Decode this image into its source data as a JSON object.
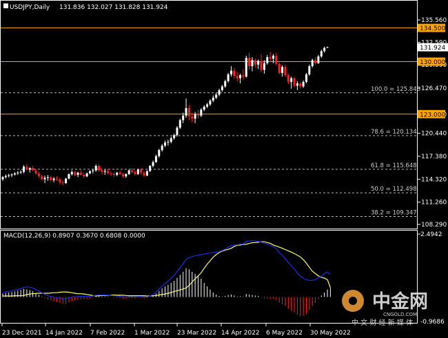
{
  "header": {
    "symbol_label": "USDJPY,Daily",
    "ohlc_text": "131.836 132.027 131.828 131.924"
  },
  "price_axis": {
    "ticks": [
      "135.560",
      "132.590",
      "129.590",
      "126.470",
      "123.000",
      "120.440",
      "117.380",
      "114.320",
      "111.260",
      "108.290"
    ]
  },
  "horizontal_levels": [
    {
      "label": "134.500",
      "color": "#ffa500"
    },
    {
      "label": "130.000",
      "color": "#ffa500"
    },
    {
      "label": "123.000",
      "color": "#ffa500"
    }
  ],
  "current_price_label": "131.924",
  "fibonacci_levels": [
    {
      "label": "100.0 = 125.848",
      "price": 125.848
    },
    {
      "label": "78.6 = 120.134",
      "price": 120.134
    },
    {
      "label": "61.8 = 115.648",
      "price": 115.648
    },
    {
      "label": "50.0 = 112.498",
      "price": 112.498
    },
    {
      "label": "38.2 = 109.347",
      "price": 109.347
    }
  ],
  "macd": {
    "header": "MACD(12,26,9) 0.8907 0.3670 0.6808 0.0000",
    "axis_top": "2.4942",
    "axis_bottom": "-0.9686"
  },
  "time_axis": {
    "labels": [
      "23 Dec 2021",
      "14 Jan 2022",
      "7 Feb 2022",
      "1 Mar 2022",
      "23 Mar 2022",
      "14 Apr 2022",
      "6 May 2022",
      "30 May 2022"
    ]
  },
  "watermark": {
    "brand_cn": "中金网",
    "domain": "CNGOLD.COM",
    "tagline": "中 文 财 经 新 媒 体"
  },
  "colors": {
    "bull": "#ffffff",
    "bear": "#ff2020",
    "level": "#ffa500",
    "macd_line": "#1a2be8",
    "signal_line": "#ffff66"
  },
  "chart_data": {
    "type": "candlestick",
    "instrument": "USDJPY",
    "timeframe": "Daily",
    "ylim": [
      108.29,
      135.56
    ],
    "x_labels": [
      "23 Dec 2021",
      "14 Jan 2022",
      "7 Feb 2022",
      "1 Mar 2022",
      "23 Mar 2022",
      "14 Apr 2022",
      "6 May 2022",
      "30 May 2022"
    ],
    "candles": [
      [
        114.3,
        114.75,
        114.1,
        114.6
      ],
      [
        114.6,
        114.95,
        114.4,
        114.75
      ],
      [
        114.75,
        115.05,
        114.55,
        114.85
      ],
      [
        114.85,
        115.1,
        114.6,
        114.95
      ],
      [
        114.95,
        115.25,
        114.8,
        115.1
      ],
      [
        115.1,
        115.4,
        114.9,
        115.2
      ],
      [
        115.2,
        115.5,
        115.0,
        115.3
      ],
      [
        115.3,
        116.2,
        115.1,
        116.0
      ],
      [
        116.0,
        116.35,
        115.5,
        115.6
      ],
      [
        115.6,
        115.9,
        115.2,
        115.8
      ],
      [
        115.8,
        116.1,
        115.4,
        115.5
      ],
      [
        115.5,
        115.7,
        114.9,
        115.1
      ],
      [
        115.1,
        115.3,
        114.5,
        114.7
      ],
      [
        114.7,
        114.9,
        114.2,
        114.3
      ],
      [
        114.3,
        114.8,
        113.8,
        114.5
      ],
      [
        114.5,
        114.9,
        114.1,
        114.6
      ],
      [
        114.6,
        114.8,
        114.0,
        114.2
      ],
      [
        114.2,
        114.6,
        113.9,
        114.4
      ],
      [
        114.4,
        114.7,
        114.1,
        114.3
      ],
      [
        114.3,
        114.5,
        113.6,
        113.9
      ],
      [
        113.9,
        114.2,
        113.5,
        113.8
      ],
      [
        113.8,
        114.5,
        113.7,
        114.4
      ],
      [
        114.4,
        115.1,
        114.3,
        115.0
      ],
      [
        115.0,
        115.5,
        114.8,
        115.3
      ],
      [
        115.3,
        115.4,
        114.7,
        114.9
      ],
      [
        114.9,
        115.3,
        114.6,
        115.2
      ],
      [
        115.2,
        115.5,
        114.8,
        114.9
      ],
      [
        114.9,
        115.2,
        114.5,
        114.7
      ],
      [
        114.7,
        115.2,
        114.6,
        115.1
      ],
      [
        115.1,
        115.5,
        115.0,
        115.4
      ],
      [
        115.4,
        115.7,
        115.1,
        115.5
      ],
      [
        115.5,
        116.3,
        115.3,
        116.1
      ],
      [
        116.1,
        116.3,
        115.3,
        115.5
      ],
      [
        115.5,
        115.8,
        115.0,
        115.3
      ],
      [
        115.3,
        115.6,
        114.9,
        115.4
      ],
      [
        115.4,
        115.7,
        115.0,
        115.1
      ],
      [
        115.1,
        115.4,
        114.7,
        115.0
      ],
      [
        115.0,
        115.3,
        114.6,
        114.9
      ],
      [
        114.9,
        115.3,
        114.7,
        115.2
      ],
      [
        115.2,
        115.5,
        114.9,
        115.0
      ],
      [
        115.0,
        115.2,
        114.5,
        114.7
      ],
      [
        114.7,
        115.1,
        114.5,
        115.0
      ],
      [
        115.0,
        115.6,
        114.9,
        115.5
      ],
      [
        115.5,
        115.8,
        115.1,
        115.3
      ],
      [
        115.3,
        115.5,
        114.8,
        115.0
      ],
      [
        115.0,
        115.7,
        114.9,
        115.6
      ],
      [
        115.6,
        115.8,
        115.0,
        115.2
      ],
      [
        115.2,
        115.4,
        114.6,
        114.8
      ],
      [
        114.8,
        115.5,
        114.7,
        115.4
      ],
      [
        115.4,
        116.2,
        115.3,
        116.1
      ],
      [
        116.1,
        116.8,
        115.9,
        116.6
      ],
      [
        116.6,
        117.6,
        116.5,
        117.4
      ],
      [
        117.4,
        118.4,
        117.2,
        118.2
      ],
      [
        118.2,
        119.0,
        118.0,
        118.8
      ],
      [
        118.8,
        119.5,
        118.6,
        119.2
      ],
      [
        119.2,
        119.6,
        118.8,
        119.3
      ],
      [
        119.3,
        120.0,
        119.1,
        119.8
      ],
      [
        119.8,
        120.4,
        119.6,
        120.2
      ],
      [
        120.2,
        121.4,
        120.0,
        121.2
      ],
      [
        121.2,
        122.4,
        121.0,
        122.2
      ],
      [
        122.2,
        123.2,
        121.8,
        122.8
      ],
      [
        122.8,
        125.1,
        122.5,
        123.8
      ],
      [
        123.8,
        124.2,
        122.2,
        122.7
      ],
      [
        122.7,
        123.2,
        121.9,
        122.4
      ],
      [
        122.4,
        123.3,
        121.8,
        123.0
      ],
      [
        123.0,
        123.6,
        122.4,
        122.8
      ],
      [
        122.8,
        123.8,
        122.6,
        123.6
      ],
      [
        123.6,
        124.2,
        123.4,
        124.0
      ],
      [
        124.0,
        124.5,
        123.8,
        124.3
      ],
      [
        124.3,
        125.0,
        124.1,
        124.8
      ],
      [
        124.8,
        125.5,
        124.6,
        125.2
      ],
      [
        125.2,
        125.8,
        125.0,
        125.6
      ],
      [
        125.6,
        126.4,
        125.4,
        126.2
      ],
      [
        126.2,
        126.9,
        126.0,
        126.7
      ],
      [
        126.7,
        127.6,
        126.5,
        127.4
      ],
      [
        127.4,
        128.5,
        127.2,
        128.3
      ],
      [
        128.3,
        129.4,
        128.0,
        128.8
      ],
      [
        128.8,
        129.2,
        127.7,
        128.1
      ],
      [
        128.1,
        128.6,
        127.4,
        127.8
      ],
      [
        127.8,
        128.4,
        127.1,
        128.2
      ],
      [
        128.2,
        129.0,
        127.6,
        128.0
      ],
      [
        128.0,
        130.8,
        127.9,
        130.5
      ],
      [
        130.5,
        131.2,
        128.9,
        129.4
      ],
      [
        129.4,
        130.6,
        128.7,
        130.2
      ],
      [
        130.2,
        130.4,
        129.2,
        129.6
      ],
      [
        129.6,
        130.3,
        129.0,
        130.1
      ],
      [
        130.1,
        131.0,
        128.6,
        128.9
      ],
      [
        128.9,
        130.2,
        128.4,
        129.8
      ],
      [
        129.8,
        130.9,
        129.6,
        130.6
      ],
      [
        130.6,
        131.3,
        130.1,
        130.4
      ],
      [
        130.4,
        131.0,
        129.8,
        130.8
      ],
      [
        130.8,
        131.2,
        129.5,
        129.7
      ],
      [
        129.7,
        129.9,
        128.3,
        128.5
      ],
      [
        128.5,
        129.5,
        128.0,
        129.3
      ],
      [
        129.3,
        129.6,
        128.0,
        128.2
      ],
      [
        128.2,
        128.4,
        127.0,
        127.3
      ],
      [
        127.3,
        128.0,
        126.4,
        127.8
      ],
      [
        127.8,
        128.0,
        126.6,
        126.8
      ],
      [
        126.8,
        127.4,
        126.2,
        127.1
      ],
      [
        127.1,
        127.3,
        126.4,
        126.7
      ],
      [
        126.7,
        127.5,
        126.5,
        127.3
      ],
      [
        127.3,
        128.5,
        127.1,
        128.3
      ],
      [
        128.3,
        129.6,
        128.1,
        129.4
      ],
      [
        129.4,
        130.4,
        129.2,
        130.2
      ],
      [
        130.2,
        130.6,
        129.6,
        129.8
      ],
      [
        129.8,
        130.9,
        129.7,
        130.7
      ],
      [
        130.7,
        131.6,
        130.5,
        131.4
      ],
      [
        131.4,
        132.0,
        131.2,
        131.836
      ],
      [
        131.836,
        132.027,
        131.828,
        131.924
      ]
    ],
    "macd_indicator": {
      "params": "MACD(12,26,9)",
      "ylim": [
        -0.9686,
        2.4942
      ],
      "histogram": [
        0.14,
        0.16,
        0.18,
        0.2,
        0.22,
        0.25,
        0.28,
        0.32,
        0.3,
        0.27,
        0.23,
        0.16,
        0.09,
        0.02,
        -0.04,
        -0.09,
        -0.14,
        -0.18,
        -0.2,
        -0.24,
        -0.27,
        -0.26,
        -0.22,
        -0.17,
        -0.14,
        -0.11,
        -0.1,
        -0.1,
        -0.08,
        -0.05,
        -0.02,
        0.03,
        0.03,
        0.02,
        0.02,
        0.01,
        -0.01,
        -0.03,
        -0.03,
        -0.04,
        -0.06,
        -0.06,
        -0.04,
        -0.04,
        -0.05,
        -0.03,
        -0.03,
        -0.05,
        -0.04,
        0.0,
        0.06,
        0.14,
        0.24,
        0.34,
        0.42,
        0.48,
        0.56,
        0.64,
        0.76,
        0.88,
        1.0,
        1.14,
        1.1,
        1.0,
        0.92,
        0.82,
        0.72,
        0.56,
        0.42,
        0.3,
        0.18,
        0.1,
        0.04,
        0.02,
        0.04,
        0.08,
        0.1,
        0.06,
        0.02,
        0.03,
        0.02,
        0.12,
        0.1,
        0.08,
        0.06,
        0.04,
        -0.02,
        -0.06,
        -0.06,
        -0.08,
        -0.06,
        -0.12,
        -0.22,
        -0.28,
        -0.36,
        -0.46,
        -0.54,
        -0.62,
        -0.7,
        -0.76,
        -0.74,
        -0.66,
        -0.52,
        -0.36,
        -0.24,
        -0.08,
        0.06,
        0.18,
        0.3,
        0.36
      ],
      "macd_line": [
        0.18,
        0.2,
        0.22,
        0.24,
        0.27,
        0.3,
        0.33,
        0.38,
        0.4,
        0.39,
        0.36,
        0.3,
        0.24,
        0.17,
        0.11,
        0.06,
        0.02,
        -0.01,
        -0.03,
        -0.05,
        -0.07,
        -0.06,
        -0.03,
        0.0,
        0.01,
        0.02,
        0.03,
        0.02,
        0.02,
        0.03,
        0.04,
        0.07,
        0.08,
        0.08,
        0.08,
        0.07,
        0.06,
        0.05,
        0.04,
        0.03,
        0.01,
        0.0,
        0.01,
        0.01,
        0.0,
        0.02,
        0.02,
        0.0,
        0.0,
        0.04,
        0.11,
        0.2,
        0.32,
        0.44,
        0.54,
        0.63,
        0.74,
        0.86,
        1.01,
        1.16,
        1.32,
        1.5,
        1.56,
        1.6,
        1.64,
        1.66,
        1.68,
        1.7,
        1.72,
        1.74,
        1.76,
        1.78,
        1.8,
        1.84,
        1.9,
        1.97,
        2.03,
        2.06,
        2.07,
        2.09,
        2.1,
        2.21,
        2.22,
        2.23,
        2.22,
        2.21,
        2.17,
        2.13,
        2.1,
        2.05,
        2.0,
        1.9,
        1.76,
        1.65,
        1.52,
        1.37,
        1.24,
        1.1,
        0.96,
        0.83,
        0.74,
        0.68,
        0.66,
        0.66,
        0.69,
        0.76,
        0.84,
        0.93,
        0.99,
        0.8907
      ],
      "signal_line": [
        0.04,
        0.04,
        0.04,
        0.04,
        0.05,
        0.05,
        0.05,
        0.06,
        0.1,
        0.12,
        0.13,
        0.14,
        0.15,
        0.15,
        0.15,
        0.15,
        0.16,
        0.17,
        0.17,
        0.19,
        0.2,
        0.2,
        0.19,
        0.17,
        0.15,
        0.13,
        0.13,
        0.12,
        0.1,
        0.08,
        0.06,
        0.04,
        0.05,
        0.06,
        0.06,
        0.06,
        0.07,
        0.08,
        0.07,
        0.07,
        0.07,
        0.06,
        0.05,
        0.05,
        0.05,
        0.05,
        0.05,
        0.05,
        0.04,
        0.04,
        0.05,
        0.06,
        0.08,
        0.1,
        0.12,
        0.15,
        0.18,
        0.22,
        0.25,
        0.28,
        0.32,
        0.36,
        0.46,
        0.6,
        0.72,
        0.84,
        0.96,
        1.14,
        1.3,
        1.44,
        1.58,
        1.68,
        1.76,
        1.82,
        1.86,
        1.89,
        1.93,
        2.0,
        2.05,
        2.06,
        2.08,
        2.09,
        2.12,
        2.15,
        2.16,
        2.17,
        2.19,
        2.19,
        2.16,
        2.13,
        2.06,
        2.02,
        1.98,
        1.93,
        1.88,
        1.83,
        1.78,
        1.72,
        1.66,
        1.59,
        1.48,
        1.34,
        1.18,
        1.02,
        0.93,
        0.84,
        0.78,
        0.75,
        0.69,
        0.367
      ]
    }
  }
}
